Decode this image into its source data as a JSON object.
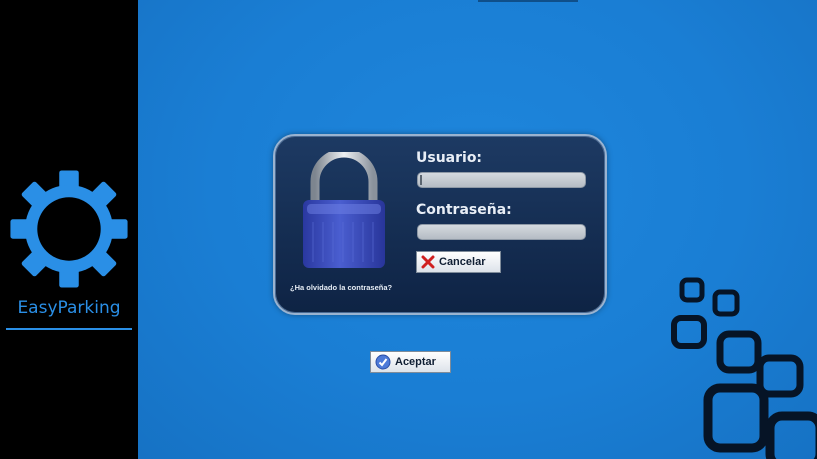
{
  "app": {
    "brand": "EasyParking"
  },
  "login": {
    "username_label": "Usuario:",
    "username_value": "",
    "password_label": "Contraseña:",
    "password_value": "",
    "cancel_label": "Cancelar",
    "forgot_password": "¿Ha olvidado la contraseña?",
    "accept_label": "Aceptar"
  },
  "icons": {
    "logo": "gear-icon",
    "lock": "padlock-icon",
    "cancel": "red-x-icon",
    "accept": "blue-check-icon",
    "decoration": "chain-links-icon"
  },
  "colors": {
    "background": "#1a7ed4",
    "sidebar": "#000000",
    "brand": "#2a8fe6",
    "panel": "#1d3a63",
    "lock": "#3d4fb8"
  }
}
